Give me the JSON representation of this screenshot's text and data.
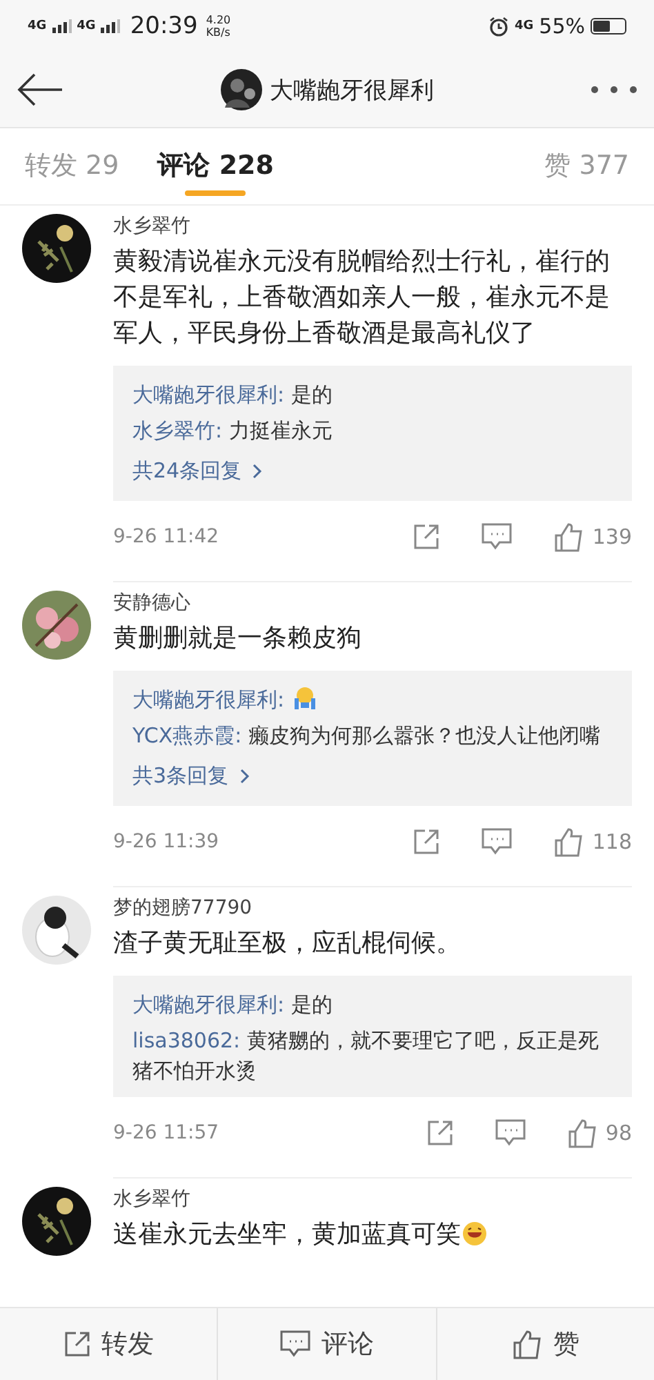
{
  "status_bar": {
    "network_1": "4G",
    "network_2": "4G",
    "time": "20:39",
    "speed_value": "4.20",
    "speed_unit": "KB/s",
    "network_3": "4G",
    "battery": "55%"
  },
  "nav": {
    "title": "大嘴龅牙很犀利"
  },
  "tabs": [
    {
      "label": "转发 29",
      "selected": false
    },
    {
      "label": "评论 228",
      "selected": true
    },
    {
      "label": "赞 377",
      "selected": false
    }
  ],
  "comments": [
    {
      "user": "水乡翠竹",
      "text": "黄毅清说崔永元没有脱帽给烈士行礼，崔行的不是军礼，上香敬酒如亲人一般，崔永元不是军人，平民身份上香敬酒是最高礼仪了",
      "emoji": false,
      "replies": [
        {
          "user": "大嘴龅牙很犀利:",
          "text": "是的",
          "emoji": false
        },
        {
          "user": "水乡翠竹:",
          "text": "力挺崔永元",
          "emoji": false
        }
      ],
      "more": "共24条回复",
      "time": "9-26 11:42",
      "likes": "139"
    },
    {
      "user": "安静德心",
      "text": "黄删删就是一条赖皮狗",
      "emoji": false,
      "replies": [
        {
          "user": "大嘴龅牙很犀利:",
          "emoji": true
        },
        {
          "user": "YCX燕赤霞:",
          "text": "癞皮狗为何那么嚣张？也没人让他闭嘴",
          "emoji": false
        }
      ],
      "more": "共3条回复",
      "time": "9-26 11:39",
      "likes": "118"
    },
    {
      "user": "梦的翅膀77790",
      "text": "渣子黄无耻至极，应乱棍伺候。",
      "emoji": false,
      "replies": [
        {
          "user": "大嘴龅牙很犀利:",
          "text": "是的",
          "emoji": false
        },
        {
          "user": "lisa38062:",
          "text": "黄猪嬲的，就不要理它了吧，反正是死猪不怕开水烫",
          "emoji": false
        }
      ],
      "time": "9-26 11:57",
      "likes": "98"
    },
    {
      "user": "水乡翠竹",
      "text": "送崔永元去坐牢，黄加蓝真可笑",
      "emoji": true
    }
  ],
  "bottom_bar": [
    {
      "kind": "repost",
      "label": "转发"
    },
    {
      "kind": "comment",
      "label": "评论"
    },
    {
      "kind": "like",
      "label": "赞"
    }
  ]
}
